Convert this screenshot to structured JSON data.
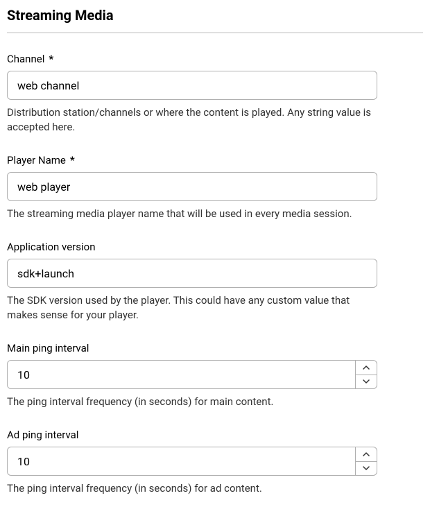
{
  "section": {
    "title": "Streaming Media"
  },
  "fields": {
    "channel": {
      "label": "Channel",
      "required": "*",
      "value": "web channel",
      "help": "Distribution station/channels or where the content is played. Any string value is accepted here."
    },
    "playerName": {
      "label": "Player Name",
      "required": "*",
      "value": "web player",
      "help": "The streaming media player name that will be used in every media session."
    },
    "appVersion": {
      "label": "Application version",
      "value": "sdk+launch",
      "help": "The SDK version used by the player. This could have any custom value that makes sense for your player."
    },
    "mainPing": {
      "label": "Main ping interval",
      "value": "10",
      "help": "The ping interval frequency (in seconds) for main content."
    },
    "adPing": {
      "label": "Ad ping interval",
      "value": "10",
      "help": "The ping interval frequency (in seconds) for ad content."
    }
  }
}
